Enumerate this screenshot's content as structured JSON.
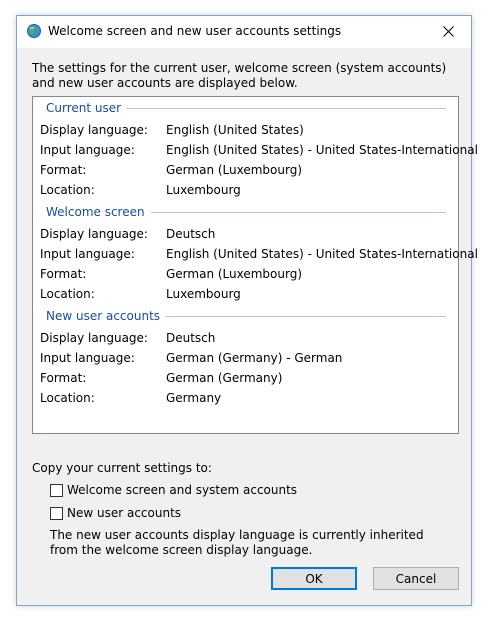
{
  "window": {
    "title": "Welcome screen and new user accounts settings",
    "icon": "globe-settings-icon",
    "close_icon": "close-icon"
  },
  "intro": "The settings for the current user, welcome screen (system accounts) and new user accounts are displayed below.",
  "labels": {
    "display_language": "Display language:",
    "input_language": "Input language:",
    "format": "Format:",
    "location": "Location:"
  },
  "sections": [
    {
      "title": "Current user",
      "display_language": "English (United States)",
      "input_language": "English (United States) - United States-International",
      "format": "German (Luxembourg)",
      "location": "Luxembourg"
    },
    {
      "title": "Welcome screen",
      "display_language": "Deutsch",
      "input_language": "English (United States) - United States-International",
      "format": "German (Luxembourg)",
      "location": "Luxembourg"
    },
    {
      "title": "New user accounts",
      "display_language": "Deutsch",
      "input_language": "German (Germany) - German",
      "format": "German (Germany)",
      "location": "Germany"
    }
  ],
  "copy": {
    "label": "Copy your current settings to:",
    "option_welcome": "Welcome screen and system accounts",
    "option_welcome_checked": false,
    "option_new_users": "New user accounts",
    "option_new_users_checked": false,
    "note": "The new user accounts display language is currently inherited from the welcome screen display language."
  },
  "buttons": {
    "ok": "OK",
    "cancel": "Cancel"
  },
  "colors": {
    "section_header": "#1a4b9c",
    "focus_border": "#0078d7",
    "window_border": "#7aa6d6"
  }
}
